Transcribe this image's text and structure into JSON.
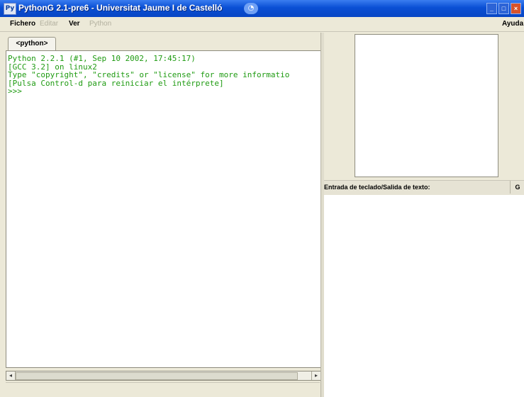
{
  "window": {
    "title": "PythonG 2.1-pre6 - Universitat Jaume I de Castelló",
    "app_icon": "python-icon",
    "buttons": [
      "_",
      "□",
      "×"
    ]
  },
  "menubar": {
    "items": [
      {
        "label": "Fichero",
        "enabled": true
      },
      {
        "label": "Editar",
        "enabled": false
      },
      {
        "label": "Ver",
        "enabled": true
      },
      {
        "label": "Python",
        "enabled": false
      }
    ],
    "help_label": "Ayuda"
  },
  "editor": {
    "tab_label": "<python>",
    "console_lines": [
      "Python 2.2.1 (#1, Sep 10 2002, 17:45:17)",
      "[GCC 3.2] on linux2",
      "Type \"copyright\", \"credits\" or \"license\" for more informatio",
      "[Pulsa Control-d para reiniciar el intérprete]",
      ">>>"
    ],
    "text_color": "#1f9b12"
  },
  "side_panel": {
    "io_label": "Entrada de teclado/Salida de texto:",
    "io_button_label": "G"
  }
}
